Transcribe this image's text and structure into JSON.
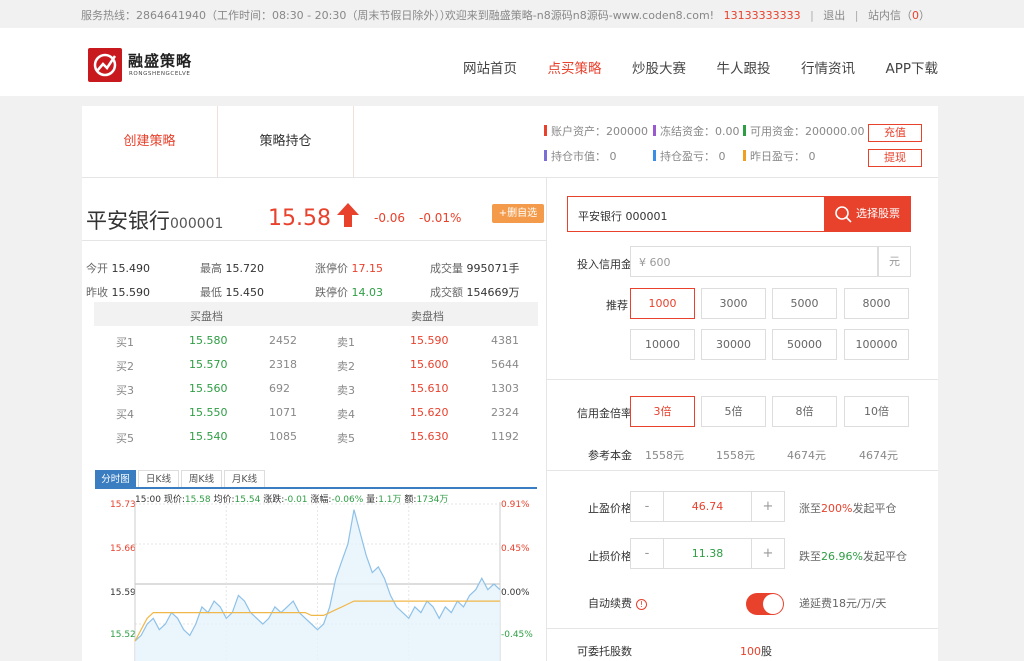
{
  "topbar": {
    "hotline": "服务热线：2864641940（工作时间：08:30 - 20:30（周末节假日除外））",
    "welcome": "欢迎来到融盛策略-n8源码n8源码-www.coden8.com!",
    "phone": "13133333333",
    "logout": "退出",
    "inbox_label": "站内信（",
    "inbox_count": "0",
    "inbox_close": "）"
  },
  "header": {
    "logo_cn": "融盛策略",
    "logo_en": "RONGSHENGCELVE",
    "nav": [
      "网站首页",
      "点买策略",
      "炒股大赛",
      "牛人跟投",
      "行情资讯",
      "APP下载"
    ],
    "active_nav": 1
  },
  "tabs": {
    "create": "创建策略",
    "hold": "策略持仓"
  },
  "account": {
    "items": [
      {
        "label": "账户资产：200000",
        "color": "#e8412c"
      },
      {
        "label": "冻结资金：0.00",
        "color": "#9b59d0"
      },
      {
        "label": "可用资金：200000.00",
        "color": "#2e9e44"
      },
      {
        "label": "持仓市值： 0",
        "color": "#7a6fd6"
      },
      {
        "label": "持仓盈亏： 0",
        "color": "#3a8ee6"
      },
      {
        "label": "昨日盈亏： 0",
        "color": "#f0a020"
      }
    ],
    "recharge": "充值",
    "withdraw": "提现"
  },
  "stock": {
    "name": "平安银行",
    "code": "000001",
    "price": "15.58",
    "change": "-0.06",
    "change_pct": "-0.01%",
    "add_fav": "+删自选",
    "quote": {
      "open_label": "今开",
      "open": "15.490",
      "high_label": "最高",
      "high": "15.720",
      "limit_up_label": "涨停价",
      "limit_up": "17.15",
      "volume_label": "成交量",
      "volume": "995071手",
      "prev_label": "昨收",
      "prev": "15.590",
      "low_label": "最低",
      "low": "15.450",
      "limit_down_label": "跌停价",
      "limit_down": "14.03",
      "amount_label": "成交额",
      "amount": "154669万"
    }
  },
  "orderbook": {
    "buy_head": "买盘档",
    "sell_head": "卖盘档",
    "rows": [
      {
        "buy": "买1",
        "buy_price": "15.580",
        "buy_vol": "2452",
        "sell": "卖1",
        "sell_price": "15.590",
        "sell_vol": "4381"
      },
      {
        "buy": "买2",
        "buy_price": "15.570",
        "buy_vol": "2318",
        "sell": "卖2",
        "sell_price": "15.600",
        "sell_vol": "5644"
      },
      {
        "buy": "买3",
        "buy_price": "15.560",
        "buy_vol": "692",
        "sell": "卖3",
        "sell_price": "15.610",
        "sell_vol": "1303"
      },
      {
        "buy": "买4",
        "buy_price": "15.550",
        "buy_vol": "1071",
        "sell": "卖4",
        "sell_price": "15.620",
        "sell_vol": "2324"
      },
      {
        "buy": "买5",
        "buy_price": "15.540",
        "buy_vol": "1085",
        "sell": "卖5",
        "sell_price": "15.630",
        "sell_vol": "1192"
      }
    ]
  },
  "chart_tabs": [
    "分时图",
    "日K线",
    "周K线",
    "月K线"
  ],
  "chart_info": {
    "time": "15:00",
    "price_label": "现价:",
    "price": "15.58",
    "avg_label": "均价:",
    "avg": "15.54",
    "chg_label": "涨跌:",
    "chg": "-0.01",
    "pct_label": "涨幅:",
    "pct": "-0.06%",
    "vol_label": "量:",
    "vol": "1.1万",
    "amt_label": "额:",
    "amt": "1734万"
  },
  "chart_data": {
    "type": "line",
    "y_ticks": [
      "15.73",
      "15.66",
      "15.59",
      "15.52"
    ],
    "pct_ticks": [
      "0.91%",
      "0.45%",
      "0.00%",
      "-0.45%"
    ],
    "ylim": [
      15.45,
      15.73
    ],
    "series": [
      {
        "values": [
          15.49,
          15.5,
          15.52,
          15.53,
          15.51,
          15.52,
          15.54,
          15.53,
          15.51,
          15.5,
          15.52,
          15.55,
          15.54,
          15.56,
          15.55,
          15.53,
          15.54,
          15.57,
          15.56,
          15.54,
          15.53,
          15.52,
          15.53,
          15.55,
          15.54,
          15.55,
          15.56,
          15.54,
          15.53,
          15.52,
          15.51,
          15.52,
          15.55,
          15.6,
          15.63,
          15.66,
          15.72,
          15.68,
          15.64,
          15.61,
          15.62,
          15.6,
          15.57,
          15.55,
          15.54,
          15.53,
          15.55,
          15.54,
          15.56,
          15.55,
          15.53,
          15.55,
          15.54,
          15.56,
          15.55,
          15.57,
          15.58,
          15.6,
          15.58,
          15.59,
          15.58
        ]
      },
      {
        "values": [
          15.49,
          15.51,
          15.53,
          15.54,
          15.54,
          15.54,
          15.54,
          15.54,
          15.54,
          15.54,
          15.54,
          15.54,
          15.54,
          15.54,
          15.54,
          15.54,
          15.54,
          15.54,
          15.54,
          15.54,
          15.54,
          15.54,
          15.54,
          15.54,
          15.54,
          15.54,
          15.54,
          15.54,
          15.54,
          15.535,
          15.535,
          15.535,
          15.54,
          15.545,
          15.55,
          15.555,
          15.56,
          15.56,
          15.56,
          15.56,
          15.56,
          15.56,
          15.56,
          15.56,
          15.56,
          15.56,
          15.56,
          15.56,
          15.56,
          15.56,
          15.56,
          15.56,
          15.56,
          15.56,
          15.56,
          15.56,
          15.56,
          15.56,
          15.56,
          15.56,
          15.56
        ]
      }
    ]
  },
  "form": {
    "search_value": "平安银行   000001",
    "search_btn": "选择股票",
    "credit_label": "投入信用金",
    "credit_placeholder": "¥ 600",
    "credit_unit": "元",
    "recommend_label": "推荐",
    "recommend": [
      "1000",
      "3000",
      "5000",
      "8000",
      "10000",
      "30000",
      "50000",
      "100000"
    ],
    "recommend_selected": 0,
    "multiple_label": "信用金倍率",
    "multiples": [
      "3倍",
      "5倍",
      "8倍",
      "10倍"
    ],
    "multiple_selected": 0,
    "ref_label": "参考本金",
    "ref_values": [
      "1558元",
      "1558元",
      "4674元",
      "4674元"
    ],
    "stop_profit_label": "止盈价格",
    "stop_profit": "46.74",
    "stop_profit_hint_a": "涨至",
    "stop_profit_hint_b": "200%",
    "stop_profit_hint_c": "发起平仓",
    "stop_loss_label": "止损价格",
    "stop_loss": "11.38",
    "stop_loss_hint_a": "跌至",
    "stop_loss_hint_b": "26.96%",
    "stop_loss_hint_c": "发起平仓",
    "minus": "-",
    "plus": "+",
    "auto_renew_label": "自动续费",
    "auto_renew_fee": "递延费18元/万/天",
    "entrust_label": "可委托股数",
    "entrust_value": "100",
    "entrust_unit": "股"
  }
}
